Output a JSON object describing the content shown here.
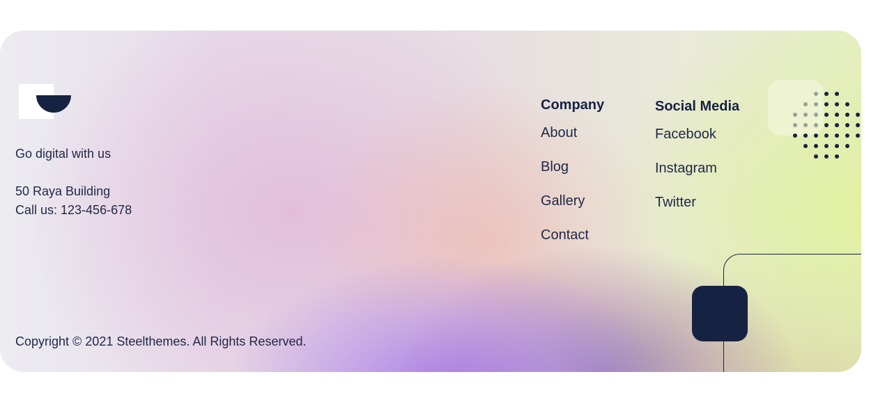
{
  "brand": {
    "logo_icon": "steelthemes-logo",
    "tagline": "Go digital with us"
  },
  "contact": {
    "address": "50 Raya Building",
    "phone": "Call us: 123-456-678"
  },
  "company": {
    "title": "Company",
    "links": [
      "About",
      "Blog",
      "Gallery",
      "Contact"
    ]
  },
  "social": {
    "title": "Social Media",
    "links": [
      "Facebook",
      "Instagram",
      "Twitter"
    ]
  },
  "copyright": "Copyright © 2021 Steelthemes. All Rights Reserved.",
  "colors": {
    "navy": "#162241",
    "text": "#1f2747",
    "accent_purple": "#a06ee6",
    "accent_lime": "#e1f0a0"
  }
}
